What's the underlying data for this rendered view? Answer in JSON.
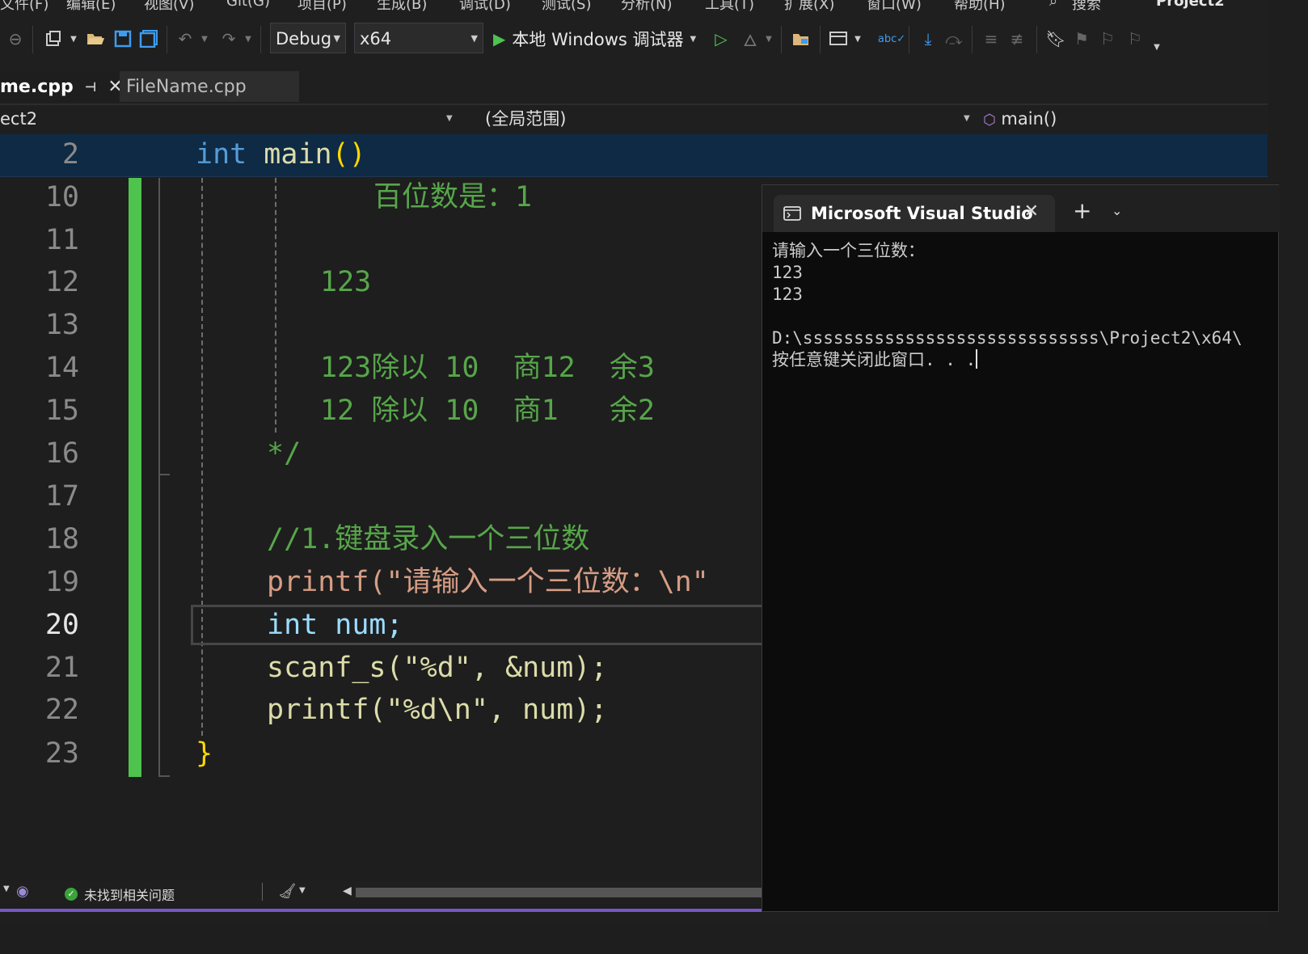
{
  "menu": [
    "文件(F)",
    "编辑(E)",
    "视图(V)",
    "Git(G)",
    "项目(P)",
    "生成(B)",
    "调试(D)",
    "测试(S)",
    "分析(N)",
    "工具(T)",
    "扩展(X)",
    "窗口(W)",
    "帮助(H)"
  ],
  "search_label": "搜索",
  "project_title": "Project2",
  "toolbar": {
    "config": "Debug",
    "platform": "x64",
    "run_label": "本地 Windows 调试器"
  },
  "tabs": [
    {
      "label": "me.cpp",
      "active": true
    },
    {
      "label": "FileName.cpp",
      "active": false
    }
  ],
  "nav": {
    "project": "ect2",
    "scope": "(全局范围)",
    "member": "main()"
  },
  "sticky": {
    "line": "2",
    "code": [
      "int",
      " main",
      "()"
    ]
  },
  "code_lines": [
    {
      "n": "10",
      "text": "百位数是：1"
    },
    {
      "n": "11",
      "text": ""
    },
    {
      "n": "12",
      "text": "123"
    },
    {
      "n": "13",
      "text": ""
    },
    {
      "n": "14",
      "text": "123除以 10  商12  余3"
    },
    {
      "n": "15",
      "text": "12 除以 10  商1   余2"
    },
    {
      "n": "16",
      "text": "*/"
    },
    {
      "n": "17",
      "text": ""
    },
    {
      "n": "18",
      "text": "//1.键盘录入一个三位数"
    },
    {
      "n": "19",
      "text": "printf(\"请输入一个三位数：\\n\""
    },
    {
      "n": "20",
      "text": "int num;"
    },
    {
      "n": "21",
      "text": "scanf_s(\"%d\", &num);"
    },
    {
      "n": "22",
      "text": "printf(\"%d\\n\", num);"
    },
    {
      "n": "23",
      "text": "}"
    }
  ],
  "console": {
    "title": "Microsoft Visual Studio",
    "lines": [
      "请输入一个三位数：",
      "123",
      "123",
      "",
      "D:\\sssssssssssssssssssssssssssss\\Project2\\x64\\",
      "按任意键关闭此窗口. . ."
    ]
  },
  "status": {
    "issues": "未找到相关问题"
  },
  "colors": {
    "accent": "#7556c7",
    "change_bar": "#4ec34e",
    "keyword": "#569cd6",
    "comment": "#57a64a",
    "string": "#d69d85"
  }
}
